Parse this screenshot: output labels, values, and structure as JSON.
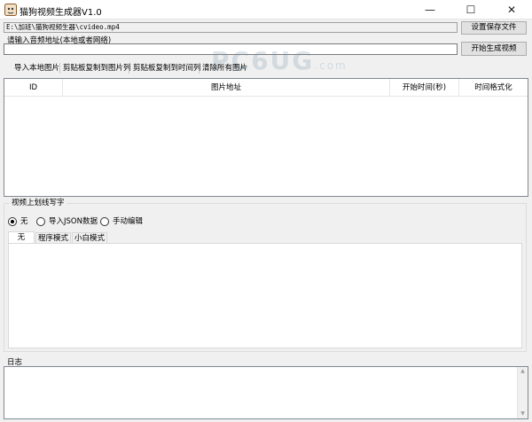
{
  "window": {
    "title": "猫狗视频生成器V1.0",
    "minimize_glyph": "—",
    "maximize_glyph": "☐",
    "close_glyph": "✕",
    "icon": "app-cat-dog-icon"
  },
  "save": {
    "path_value": "E:\\加班\\猫狗视频生器\\cvideo.mp4",
    "button_label": "设置保存文件"
  },
  "audio": {
    "label": "请输入音频地址(本地或者网络)",
    "value": "",
    "generate_button_label": "开始生成视频"
  },
  "toolbar": {
    "items": [
      "导入本地图片",
      "剪贴板复制到图片列",
      "剪贴板复制到时间列",
      "清除所有图片"
    ]
  },
  "image_table": {
    "columns": [
      "ID",
      "图片地址",
      "开始时间(秒)",
      "时间格式化"
    ],
    "rows": []
  },
  "subtitle_group": {
    "label": "视频上划线写字",
    "options": [
      {
        "label": "无",
        "selected": true
      },
      {
        "label": "导入JSON数据",
        "selected": false
      },
      {
        "label": "手动编辑",
        "selected": false
      }
    ],
    "tabs": [
      "无",
      "程序模式",
      "小白模式"
    ],
    "active_tab": 0
  },
  "log": {
    "label": "日志",
    "value": ""
  },
  "watermark": {
    "text": "PC6UG",
    "suffix": ".com"
  }
}
